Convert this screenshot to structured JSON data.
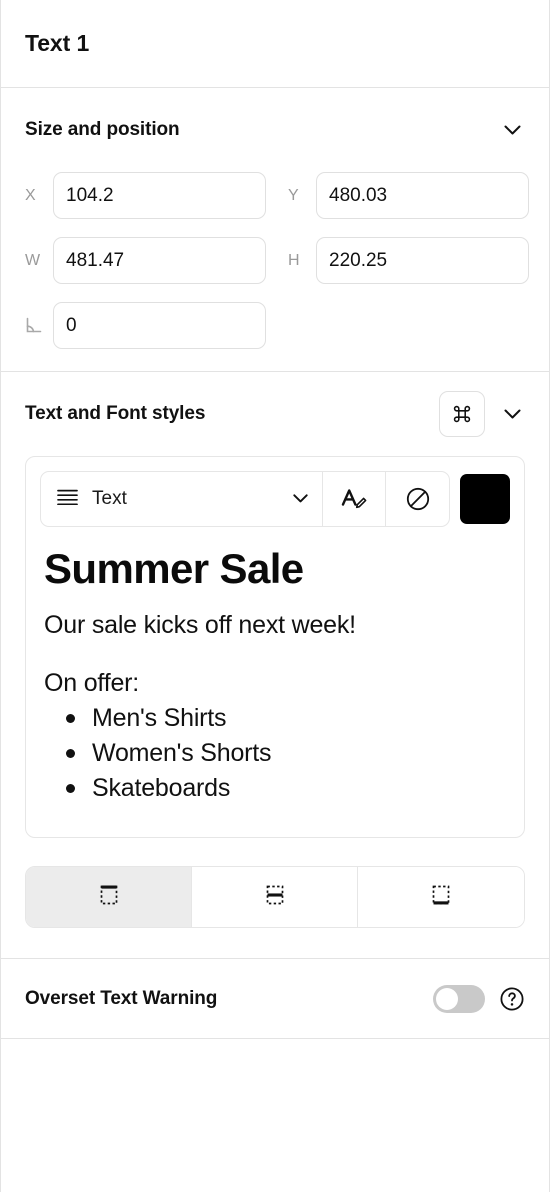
{
  "header": {
    "title": "Text 1"
  },
  "size_section": {
    "title": "Size and position",
    "collapse_icon": "chevron-down-icon",
    "fields": {
      "x": {
        "label": "X",
        "value": "104.2"
      },
      "y": {
        "label": "Y",
        "value": "480.03"
      },
      "w": {
        "label": "W",
        "value": "481.47"
      },
      "h": {
        "label": "H",
        "value": "220.25"
      },
      "rotation": {
        "label": "angle-icon",
        "value": "0"
      }
    }
  },
  "text_section": {
    "title": "Text and Font styles",
    "command_icon": "command-key-icon",
    "collapse_icon": "chevron-down-icon",
    "toolbar": {
      "list_icon": "paragraph-lines-icon",
      "style_name": "Text",
      "dropdown_icon": "chevron-down-icon",
      "edit_style_icon": "font-edit-icon",
      "clear_style_icon": "no-style-icon",
      "color_swatch_icon": "color-swatch",
      "color": "#000000"
    },
    "preview": {
      "heading": "Summer Sale",
      "paragraph": "Our sale kicks off next week!",
      "list_intro": "On offer:",
      "list_items": [
        "Men's Shirts",
        "Women's Shorts",
        "Skateboards"
      ]
    },
    "vertical_align": {
      "selected": 0,
      "options": [
        {
          "name": "align-top",
          "icon": "align-top-icon"
        },
        {
          "name": "align-middle",
          "icon": "align-middle-icon"
        },
        {
          "name": "align-bottom",
          "icon": "align-bottom-icon"
        }
      ]
    }
  },
  "overset": {
    "label": "Overset Text Warning",
    "enabled": false,
    "help_icon": "question-circle-icon"
  },
  "colors": {
    "border": "#e3e3e3",
    "field_border": "#e0e0e0",
    "label": "#9a9a9a",
    "text": "#111111",
    "selected_segment": "#ececec",
    "toggle_off": "#c9c9c9"
  }
}
